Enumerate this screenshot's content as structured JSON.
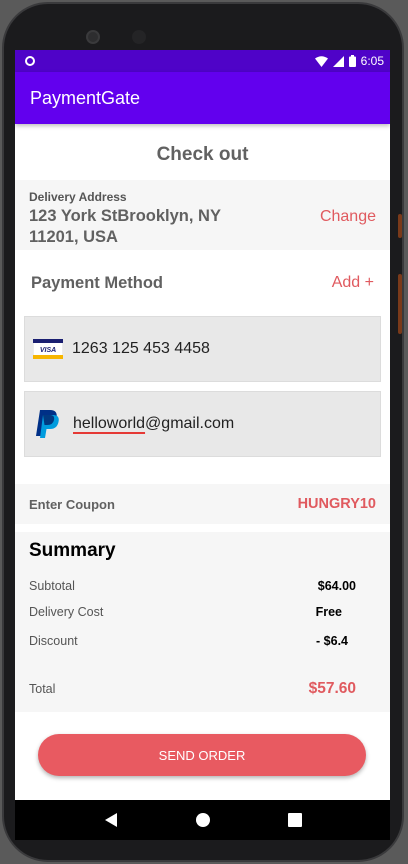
{
  "status_bar": {
    "time": "6:05"
  },
  "app_bar": {
    "title": "PaymentGate"
  },
  "page_title": "Check out",
  "delivery": {
    "label": "Delivery Address",
    "address": "123 York StBrooklyn, NY 11201, USA",
    "change_label": "Change"
  },
  "payment": {
    "title": "Payment Method",
    "add_label": "Add +",
    "methods": [
      {
        "icon": "visa-icon",
        "text": "1263 125 453 4458"
      },
      {
        "icon": "paypal-icon",
        "text_underlined": "helloworld",
        "text_rest": "@gmail.com"
      }
    ]
  },
  "coupon": {
    "label": "Enter Coupon",
    "code": "HUNGRY10"
  },
  "summary": {
    "title": "Summary",
    "subtotal_label": "Subtotal",
    "subtotal_value": "$64.00",
    "delivery_label": "Delivery Cost",
    "delivery_value": "Free",
    "discount_label": "Discount",
    "discount_value": "- $6.4",
    "total_label": "Total",
    "total_value": "$57.60"
  },
  "send_button": "SEND ORDER",
  "colors": {
    "app_bar": "#6200ee",
    "status_bar": "#4f03c8",
    "accent": "#e05a5f",
    "button": "#e85a61"
  }
}
